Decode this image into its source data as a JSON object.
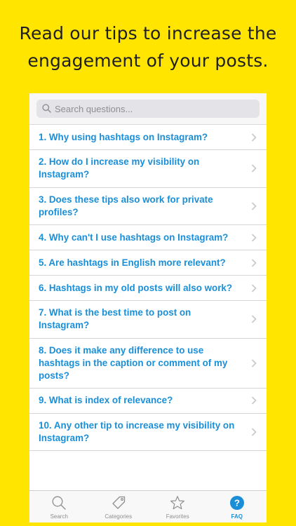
{
  "headline": {
    "line1": "Read our tips to increase the",
    "line2": "engagement of your posts."
  },
  "search": {
    "placeholder": "Search questions..."
  },
  "faq": [
    {
      "question": "1. Why using hashtags on Instagram?"
    },
    {
      "question": "2. How do I increase my visibility on Instagram?"
    },
    {
      "question": "3. Does these tips also work for private profiles?"
    },
    {
      "question": "4. Why can't I use hashtags on Instagram?"
    },
    {
      "question": "5. Are hashtags in English more relevant?"
    },
    {
      "question": "6. Hashtags in my old posts will also work?"
    },
    {
      "question": "7. What is the best time to post on Instagram?"
    },
    {
      "question": "8. Does it make any difference to use hashtags in the caption or comment of my posts?"
    },
    {
      "question": "9. What is index of relevance?"
    },
    {
      "question": "10. Any other tip to increase my visibility on Instagram?"
    }
  ],
  "tabbar": {
    "tabs": [
      {
        "label": "Search",
        "icon": "search-icon",
        "active": false
      },
      {
        "label": "Categories",
        "icon": "tag-icon",
        "active": false
      },
      {
        "label": "Favorites",
        "icon": "star-icon",
        "active": false
      },
      {
        "label": "FAQ",
        "icon": "question-icon",
        "active": true
      }
    ]
  },
  "colors": {
    "background": "#FFE500",
    "link": "#1A8FD8",
    "headline": "#1F1F1F"
  }
}
